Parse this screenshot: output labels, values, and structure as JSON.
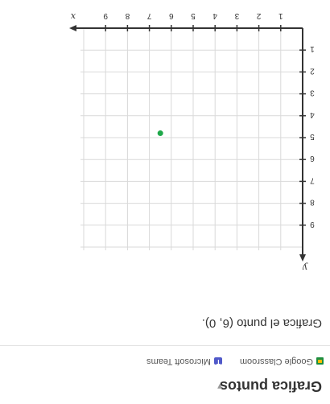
{
  "header": {
    "title": "Grafica puntos"
  },
  "share": {
    "classroom_label": "Google Classroom",
    "teams_label": "Microsoft Teams"
  },
  "question": {
    "prompt": "Grafica el punto (6, 0)."
  },
  "colors": {
    "point": "#1fa84a",
    "axis": "#333333",
    "grid": "#d9d9d9"
  },
  "chart_data": {
    "type": "scatter",
    "xlabel": "x",
    "ylabel": "y",
    "xlim": [
      0,
      10
    ],
    "ylim": [
      0,
      10
    ],
    "x_ticks": [
      1,
      2,
      3,
      4,
      5,
      6,
      7,
      8,
      9
    ],
    "y_ticks": [
      1,
      2,
      3,
      4,
      5,
      6,
      7,
      8,
      9
    ],
    "grid": true,
    "series": [
      {
        "points": [
          {
            "x": 6.5,
            "y": 4.8
          }
        ]
      }
    ]
  }
}
